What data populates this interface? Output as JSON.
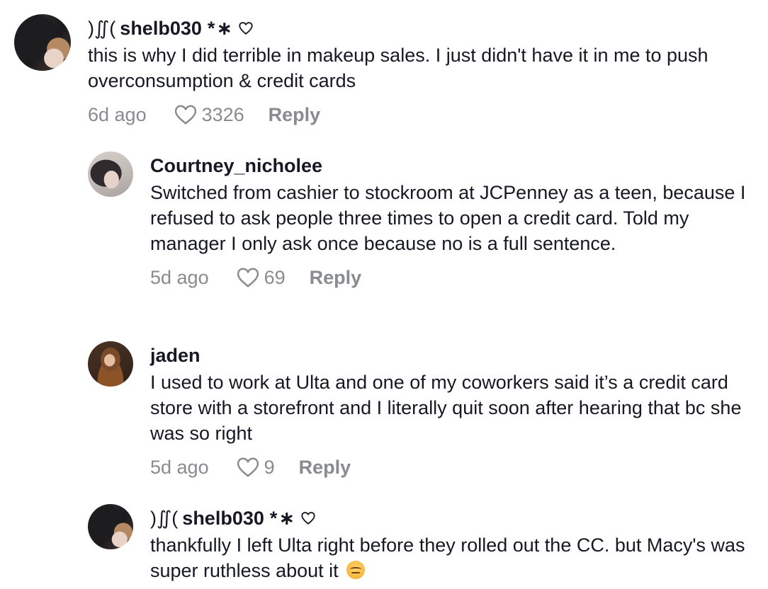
{
  "comments": [
    {
      "username": "shelb030",
      "prefix_glyph": ")∬(",
      "suffix": "*∗",
      "text": "this is why I did terrible in makeup sales. I just didn't have it in me to push overconsumption & credit cards",
      "time": "6d ago",
      "likes": "3326",
      "reply_label": "Reply"
    },
    {
      "username": "Courtney_nicholee",
      "text": "Switched from cashier to stockroom at JCPenney as a teen, because I refused to ask people three times to open a credit card. Told my manager I only ask once because no is a full sentence.",
      "time": "5d ago",
      "likes": "69",
      "reply_label": "Reply"
    },
    {
      "username": "jaden",
      "text": "I used to work at Ulta and one of my coworkers said it’s a credit card store with a storefront and I literally quit soon after hearing that bc she was so right",
      "time": "5d ago",
      "likes": "9",
      "reply_label": "Reply"
    },
    {
      "username": "shelb030",
      "prefix_glyph": ")∬(",
      "suffix": "*∗",
      "text": "thankfully I left Ulta right before they rolled out the CC. but Macy's was super ruthless about it",
      "emoji": "confounded-face-emoji"
    }
  ],
  "colors": {
    "text": "#161823",
    "muted": "#8a8b91",
    "background": "#ffffff"
  },
  "icons": {
    "like": "heart-outline-icon",
    "name_badge": "heart-outline-icon"
  }
}
